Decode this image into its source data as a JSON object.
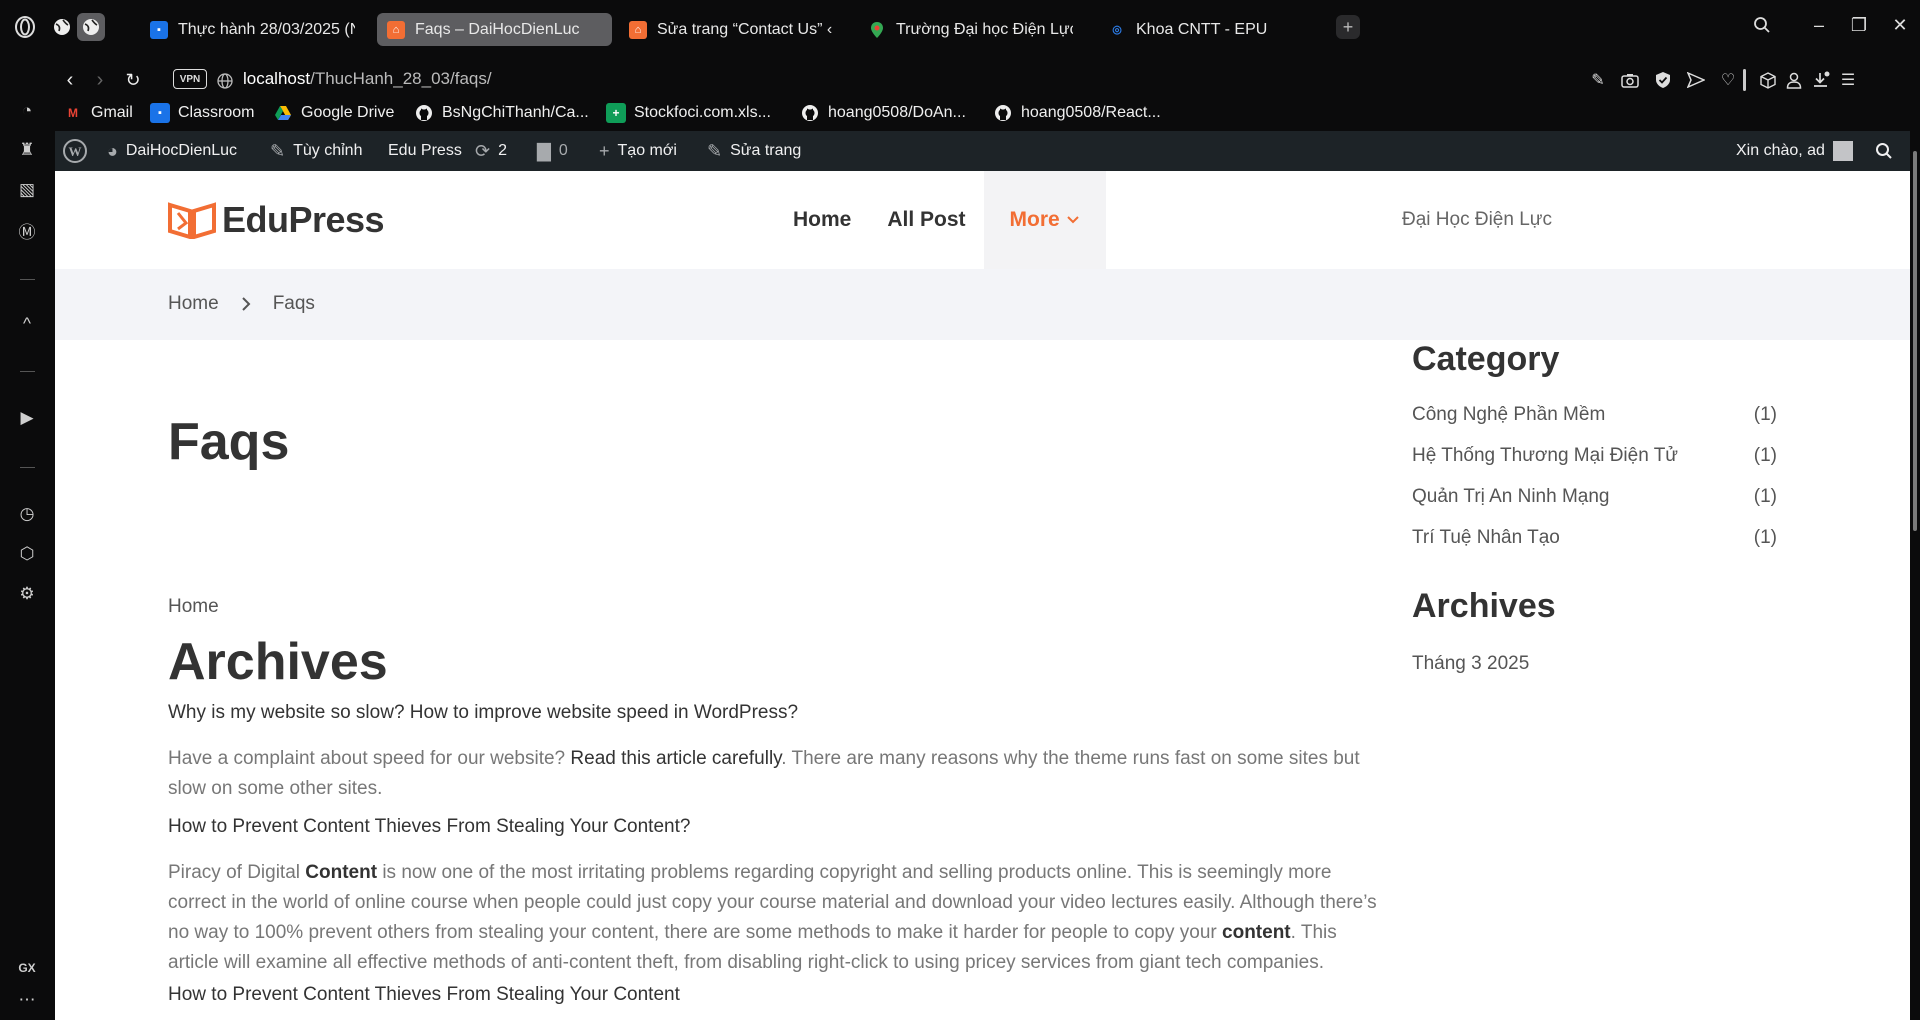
{
  "browser": {
    "tabs": [
      {
        "title": "Thực hành 28/03/2025 (N",
        "active": false
      },
      {
        "title": "Faqs – DaiHocDienLuc",
        "active": true
      },
      {
        "title": "Sửa trang “Contact Us” ‹ [",
        "active": false
      },
      {
        "title": "Trường Đại học Điện Lực -",
        "active": false
      },
      {
        "title": "Khoa CNTT - EPU",
        "active": false
      }
    ],
    "vpn_label": "VPN",
    "url_host": "localhost",
    "url_path": "/ThucHanh_28_03/faqs/",
    "bookmarks": [
      {
        "label": "Gmail",
        "icon": "gmail-icon"
      },
      {
        "label": "Classroom",
        "icon": "classroom-icon"
      },
      {
        "label": "Google Drive",
        "icon": "drive-icon"
      },
      {
        "label": "BsNgChiThanh/Ca...",
        "icon": "github-icon"
      },
      {
        "label": "Stockfoci.com.xls...",
        "icon": "sheets-icon"
      },
      {
        "label": "hoang0508/DoAn...",
        "icon": "github-icon"
      },
      {
        "label": "hoang0508/React...",
        "icon": "github-icon"
      }
    ],
    "sidebar_label": "GX"
  },
  "wp_admin": {
    "site_name": "DaiHocDienLuc",
    "customize": "Tùy chỉnh",
    "theme": "Edu Press",
    "updates": "2",
    "comments": "0",
    "new": "Tạo mới",
    "edit": "Sửa trang",
    "greeting": "Xin chào, ad"
  },
  "site": {
    "logo_text": "EduPress",
    "menu": [
      {
        "label": "Home"
      },
      {
        "label": "All Post"
      },
      {
        "label": "More"
      }
    ],
    "header_right": "Đại Học Điện Lực",
    "breadcrumb": {
      "home": "Home",
      "current": "Faqs"
    }
  },
  "content": {
    "title": "Faqs",
    "home_link": "Home",
    "archives_heading": "Archives",
    "q1": "Why is my website so slow? How to improve website speed in WordPress?",
    "p1_a": "Have a complaint about speed for our website? ",
    "p1_b": "Read this article carefully",
    "p1_c": ". There are many reasons why the theme runs fast on some sites but slow on some other sites.",
    "q2": "How to Prevent Content Thieves From Stealing Your Content?",
    "p2_a": "Piracy of Digital ",
    "p2_b": "Content",
    "p2_c": " is now one of the most irritating problems regarding copyright and selling products online. This is seemingly more correct in the world of online course when people could just copy your course material and download your video lectures easily. Although there’s no way to 100% prevent others from stealing your content, there are some methods to make it harder for people to copy your ",
    "p2_d": "content",
    "p2_e": ". This article will examine all effective methods of anti-content theft, from disabling right-click to using pricey services from giant tech companies.",
    "q3": "How to Prevent Content Thieves From Stealing Your Content"
  },
  "sidebar_widgets": {
    "category_title": "Category",
    "categories": [
      {
        "name": "Công Nghệ Phần Mềm",
        "count": "(1)"
      },
      {
        "name": "Hệ Thống Thương Mại Điện Tử",
        "count": "(1)"
      },
      {
        "name": "Quản Trị An Ninh Mạng",
        "count": "(1)"
      },
      {
        "name": "Trí Tuệ Nhân Tạo",
        "count": "(1)"
      }
    ],
    "archives_title": "Archives",
    "archives": [
      {
        "label": "Tháng 3 2025"
      }
    ]
  },
  "colors": {
    "accent": "#f26e34",
    "admin_bar": "#1d2327",
    "crumb_bg": "#f3f4f8"
  }
}
